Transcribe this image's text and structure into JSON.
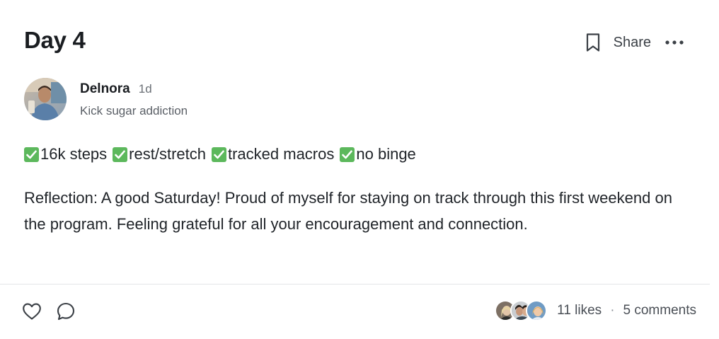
{
  "post": {
    "title": "Day 4",
    "share_label": "Share",
    "author": {
      "name": "Delnora",
      "age": "1d",
      "group": "Kick sugar addiction"
    },
    "checklist": [
      {
        "label": "16k steps",
        "checked": true
      },
      {
        "label": "rest/stretch",
        "checked": true
      },
      {
        "label": "tracked macros",
        "checked": true
      },
      {
        "label": "no binge",
        "checked": true
      }
    ],
    "reflection": "Reflection: A good Saturday!  Proud of myself for staying on track through this first weekend on the program.  Feeling grateful for all your encouragement and connection.",
    "likes_label": "11 likes",
    "separator": "·",
    "comments_label": "5 comments"
  },
  "icons": {
    "bookmark": "bookmark-icon",
    "more": "more-horizontal-icon",
    "like": "heart-icon",
    "comment": "comment-bubble-icon",
    "check": "checkmark-icon"
  },
  "colors": {
    "check_green": "#5cb85c",
    "text_primary": "#1f2328",
    "text_secondary": "#5a5f66",
    "divider": "#e3e5e8"
  }
}
